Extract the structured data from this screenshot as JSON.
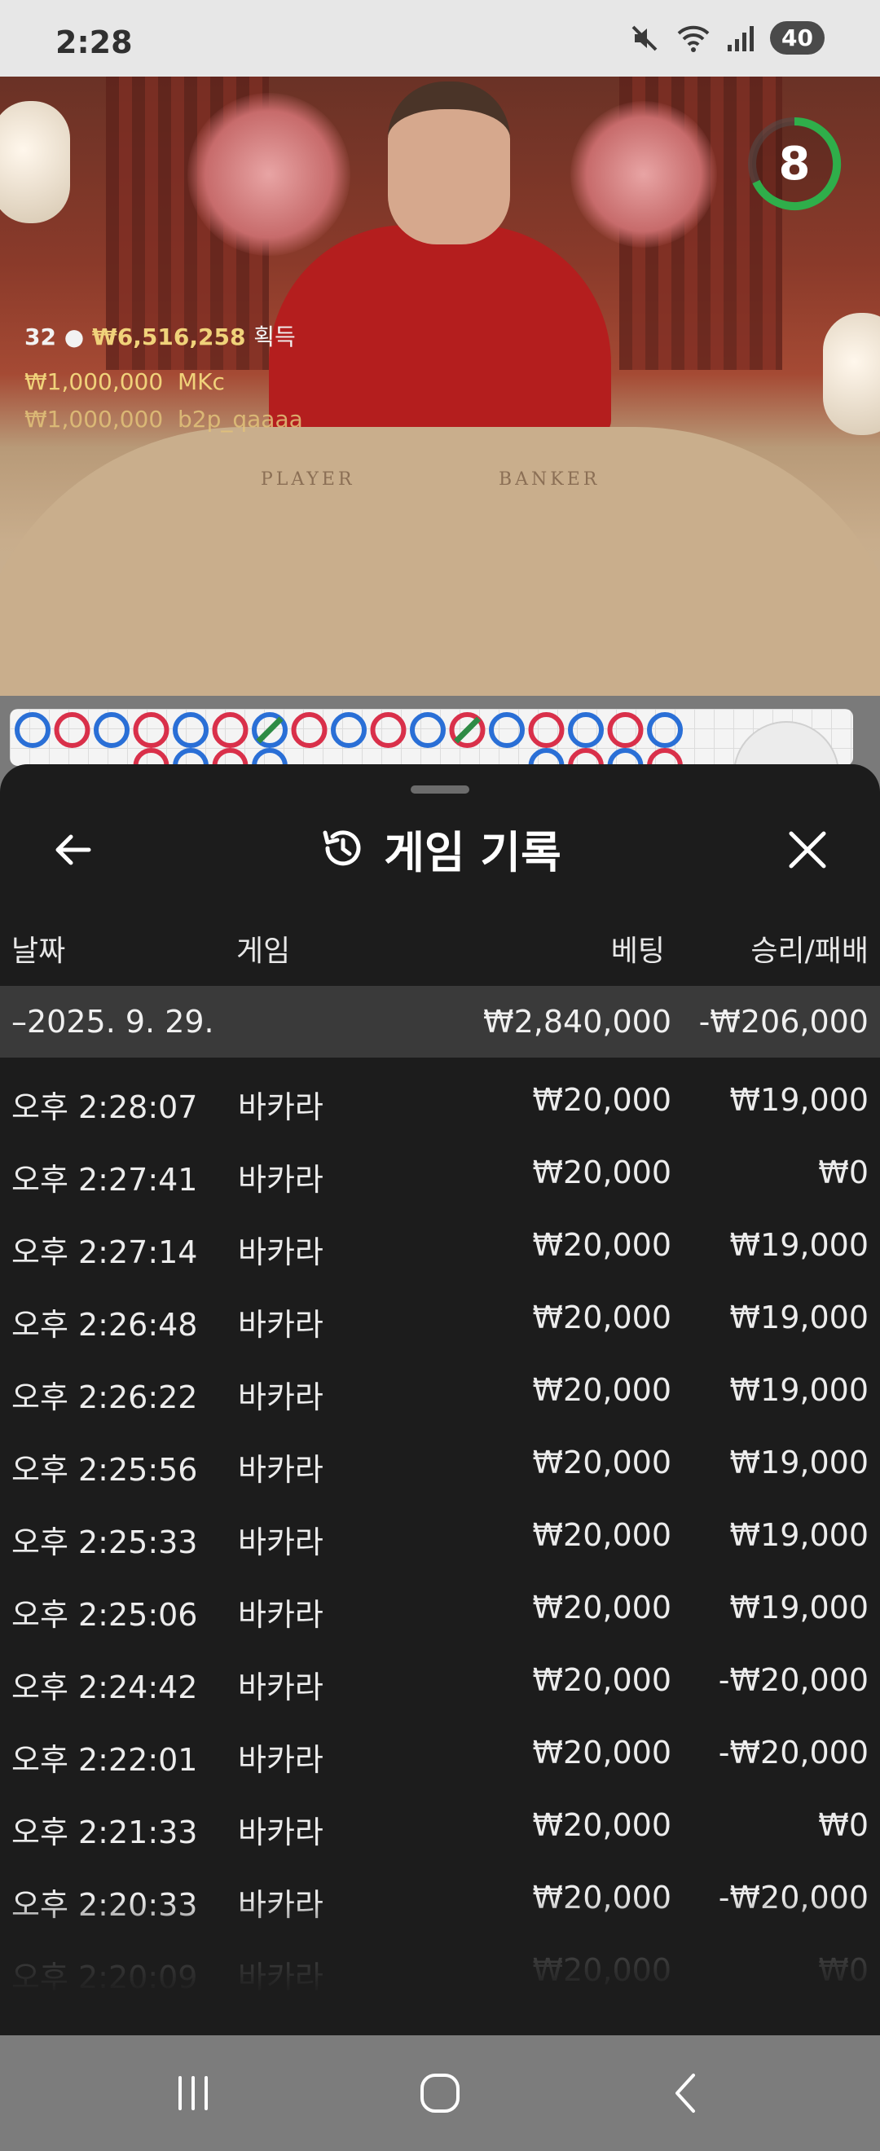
{
  "status_bar": {
    "time": "2:28",
    "battery": "40"
  },
  "video": {
    "countdown": "8",
    "table_player": "PLAYER",
    "table_banker": "BANKER",
    "winners": {
      "count": "32",
      "total": "₩6,516,258",
      "suffix": "획득",
      "entries": [
        {
          "amount": "₩1,000,000",
          "name": "MKc"
        },
        {
          "amount": "₩1,000,000",
          "name": "b2p_qaaaa"
        }
      ]
    }
  },
  "roadmap": {
    "colors": {
      "banker": "#d9304a",
      "player": "#2a6fd6",
      "tie": "#2e8b45"
    },
    "top_row": [
      "P",
      "B",
      "P",
      "B",
      "P",
      "B",
      "T",
      "B",
      "P",
      "B",
      "P",
      "T",
      "P",
      "B",
      "P",
      "B",
      "P"
    ],
    "second_row": [
      "",
      "",
      "",
      "B",
      "P",
      "B",
      "P",
      "",
      "",
      "",
      "",
      "",
      "",
      "P",
      "B",
      "P",
      "B"
    ]
  },
  "sheet": {
    "title": "게임 기록",
    "columns": {
      "date": "날짜",
      "game": "게임",
      "bet": "베팅",
      "winloss": "승리/패배"
    },
    "date_group": {
      "date": "–2025. 9. 29.",
      "bet": "₩2,840,000",
      "winloss": "-₩206,000"
    },
    "rows": [
      {
        "time": "오후 2:28:07",
        "game": "바카라",
        "bet": "₩20,000",
        "winloss": "₩19,000"
      },
      {
        "time": "오후 2:27:41",
        "game": "바카라",
        "bet": "₩20,000",
        "winloss": "₩0"
      },
      {
        "time": "오후 2:27:14",
        "game": "바카라",
        "bet": "₩20,000",
        "winloss": "₩19,000"
      },
      {
        "time": "오후 2:26:48",
        "game": "바카라",
        "bet": "₩20,000",
        "winloss": "₩19,000"
      },
      {
        "time": "오후 2:26:22",
        "game": "바카라",
        "bet": "₩20,000",
        "winloss": "₩19,000"
      },
      {
        "time": "오후 2:25:56",
        "game": "바카라",
        "bet": "₩20,000",
        "winloss": "₩19,000"
      },
      {
        "time": "오후 2:25:33",
        "game": "바카라",
        "bet": "₩20,000",
        "winloss": "₩19,000"
      },
      {
        "time": "오후 2:25:06",
        "game": "바카라",
        "bet": "₩20,000",
        "winloss": "₩19,000"
      },
      {
        "time": "오후 2:24:42",
        "game": "바카라",
        "bet": "₩20,000",
        "winloss": "-₩20,000"
      },
      {
        "time": "오후 2:22:01",
        "game": "바카라",
        "bet": "₩20,000",
        "winloss": "-₩20,000"
      },
      {
        "time": "오후 2:21:33",
        "game": "바카라",
        "bet": "₩20,000",
        "winloss": "₩0"
      },
      {
        "time": "오후 2:20:33",
        "game": "바카라",
        "bet": "₩20,000",
        "winloss": "-₩20,000"
      },
      {
        "time": "오후 2:20:09",
        "game": "바카라",
        "bet": "₩20,000",
        "winloss": "₩0"
      }
    ]
  }
}
